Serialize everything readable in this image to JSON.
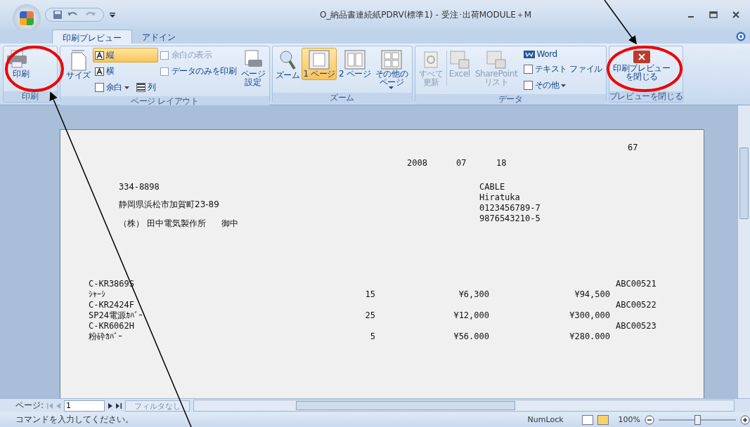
{
  "window": {
    "title": "O_納品書連続紙PDRV(標準1) - 受注･出荷MODULE＋M"
  },
  "tabs": [
    {
      "label": "印刷プレビュー",
      "selected": true
    },
    {
      "label": "アドイン",
      "selected": false
    }
  ],
  "ribbon": {
    "print": {
      "label": "印刷",
      "button": "印刷"
    },
    "page_layout": {
      "label": "ページ レイアウト",
      "size": "サイズ",
      "portrait": {
        "label": "縦",
        "selected": true
      },
      "landscape": {
        "label": "横",
        "selected": false
      },
      "margins": "余白",
      "columns": "列",
      "show_margins": {
        "label": "余白の表示",
        "checked": false,
        "disabled": true
      },
      "print_data_only": {
        "label": "データのみを印刷",
        "checked": false,
        "disabled": false
      },
      "page_setup": "ページ設定"
    },
    "zoom": {
      "label": "ズーム",
      "zoom": "ズーム",
      "one_page": {
        "label": "1 ページ",
        "selected": true
      },
      "two_pages": {
        "label": "2 ページ",
        "selected": false
      },
      "more_pages": "その他のページ"
    },
    "data": {
      "label": "データ",
      "refresh_all": {
        "label": "すべて更新",
        "disabled": true
      },
      "excel": {
        "label": "Excel",
        "disabled": true
      },
      "sharepoint": {
        "label": "SharePoint リスト",
        "disabled": true
      },
      "word": "Word",
      "text_file": "テキスト ファイル",
      "more": "その他"
    },
    "close": {
      "label": "プレビューを閉じる",
      "button": "印刷プレビューを閉じる"
    }
  },
  "document": {
    "page_number": "67",
    "date": [
      "2008",
      "07",
      "18"
    ],
    "recipient": {
      "postal_code": "334-8898",
      "address": "静岡県浜松市加賀町23-89",
      "company": "（株） 田中電気製作所",
      "honorific": "御中"
    },
    "sender": [
      "CABLE",
      "Hiratuka",
      "0123456789-7",
      "9876543210-5"
    ],
    "items": [
      {
        "code": "C-KR3869S",
        "name": "ｼｬｰｼ",
        "quantity": "15",
        "unit_price": "¥6,300",
        "amount": "¥94,500",
        "reference": "ABC00521"
      },
      {
        "code": "C-KR2424F",
        "name": "SP24電源ｶﾊﾞｰ",
        "quantity": "25",
        "unit_price": "¥12,000",
        "amount": "¥300,000",
        "reference": "ABC00522"
      },
      {
        "code": "C-KR6062H",
        "name": "粉砕ｶﾊﾞｰ",
        "quantity": "5",
        "unit_price": "¥56.000",
        "amount": "¥280.000",
        "reference": "ABC00523"
      }
    ]
  },
  "navigation": {
    "label": "ページ:",
    "current_page": "1",
    "filter": "フィルタなし"
  },
  "status_bar": {
    "message": "コマンドを入力してください。",
    "numlock": "NumLock",
    "zoom": "100%",
    "zoom_level": {
      "level": 0.5
    }
  }
}
